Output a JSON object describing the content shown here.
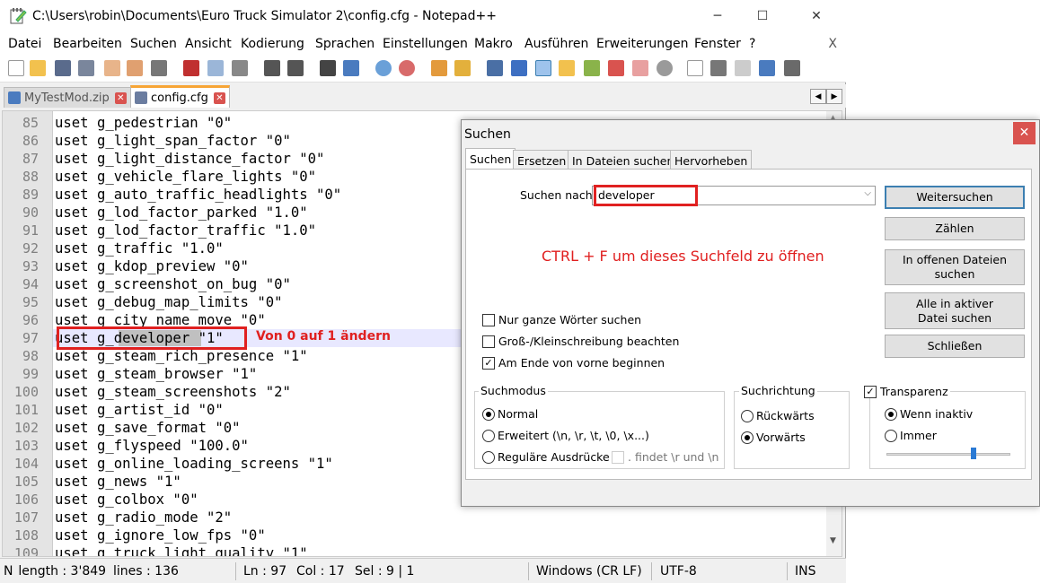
{
  "window": {
    "title": "C:\\Users\\robin\\Documents\\Euro Truck Simulator 2\\config.cfg - Notepad++",
    "minimize": "─",
    "maximize": "☐",
    "close": "✕"
  },
  "menu": [
    "Datei",
    "Bearbeiten",
    "Suchen",
    "Ansicht",
    "Kodierung",
    "Sprachen",
    "Einstellungen",
    "Makro",
    "Ausführen",
    "Erweiterungen",
    "Fenster",
    "?"
  ],
  "menu_close": "X",
  "tabs": [
    {
      "label": "MyTestMod.zip",
      "close": "✕"
    },
    {
      "label": "config.cfg",
      "close": "✕"
    }
  ],
  "tabnav": {
    "left": "◀",
    "right": "▶"
  },
  "editor": {
    "lines": [
      {
        "num": "85",
        "text": "uset g_pedestrian \"0\""
      },
      {
        "num": "86",
        "text": "uset g_light_span_factor \"0\""
      },
      {
        "num": "87",
        "text": "uset g_light_distance_factor \"0\""
      },
      {
        "num": "88",
        "text": "uset g_vehicle_flare_lights \"0\""
      },
      {
        "num": "89",
        "text": "uset g_auto_traffic_headlights \"0\""
      },
      {
        "num": "90",
        "text": "uset g_lod_factor_parked \"1.0\""
      },
      {
        "num": "91",
        "text": "uset g_lod_factor_traffic \"1.0\""
      },
      {
        "num": "92",
        "text": "uset g_traffic \"1.0\""
      },
      {
        "num": "93",
        "text": "uset g_kdop_preview \"0\""
      },
      {
        "num": "94",
        "text": "uset g_screenshot_on_bug \"0\""
      },
      {
        "num": "95",
        "text": "uset g_debug_map_limits \"0\""
      },
      {
        "num": "96",
        "text": "uset g_city_name_move \"0\""
      },
      {
        "num": "97",
        "text": "uset g_developer \"1\""
      },
      {
        "num": "98",
        "text": "uset g_steam_rich_presence \"1\""
      },
      {
        "num": "99",
        "text": "uset g_steam_browser \"1\""
      },
      {
        "num": "100",
        "text": "uset g_steam_screenshots \"2\""
      },
      {
        "num": "101",
        "text": "uset g_artist_id \"0\""
      },
      {
        "num": "102",
        "text": "uset g_save_format \"0\""
      },
      {
        "num": "103",
        "text": "uset g_flyspeed \"100.0\""
      },
      {
        "num": "104",
        "text": "uset g_online_loading_screens \"1\""
      },
      {
        "num": "105",
        "text": "uset g_news \"1\""
      },
      {
        "num": "106",
        "text": "uset g_colbox \"0\""
      },
      {
        "num": "107",
        "text": "uset g_radio_mode \"2\""
      },
      {
        "num": "108",
        "text": "uset g_ignore_low_fps \"0\""
      },
      {
        "num": "109",
        "text": "uset g_truck_light_quality \"1\""
      }
    ],
    "annotation": "Von 0 auf 1 ändern",
    "scroll_up": "▲",
    "scroll_down": "▼"
  },
  "status": {
    "length": "N  length : 3'849",
    "lines": "lines : 136",
    "ln": "Ln : 97",
    "col": "Col : 17",
    "sel": "Sel : 9 | 1",
    "eol": "Windows (CR LF)",
    "encoding": "UTF-8",
    "mode": "INS"
  },
  "dialog": {
    "title": "Suchen",
    "close": "✕",
    "tabs": [
      "Suchen",
      "Ersetzen",
      "In Dateien suchen",
      "Hervorheben"
    ],
    "find_label": "Suchen nach:",
    "find_value": "developer",
    "combo_chevron": "⌵",
    "hint": "CTRL + F um dieses Suchfeld zu öffnen",
    "buttons": [
      "Weitersuchen",
      "Zählen",
      "In offenen Dateien suchen",
      "Alle in aktiver Datei suchen",
      "Schließen"
    ],
    "checkboxes": [
      {
        "label": "Nur ganze Wörter suchen",
        "checked": false
      },
      {
        "label": "Groß-/Kleinschreibung beachten",
        "checked": false
      },
      {
        "label": "Am Ende von vorne beginnen",
        "checked": true
      }
    ],
    "check_mark": "✓",
    "search_mode": {
      "label": "Suchmodus",
      "options": [
        "Normal",
        "Erweitert (\\n, \\r, \\t, \\0, \\x...)",
        "Reguläre Ausdrücke"
      ],
      "selected": 0,
      "dotall_label": ". findet \\r und \\n"
    },
    "direction": {
      "label": "Suchrichtung",
      "options": [
        "Rückwärts",
        "Vorwärts"
      ],
      "selected": 1
    },
    "transparency": {
      "label": "Transparenz",
      "checked": true,
      "options": [
        "Wenn inaktiv",
        "Immer"
      ],
      "selected": 0,
      "level": 0.7
    }
  }
}
